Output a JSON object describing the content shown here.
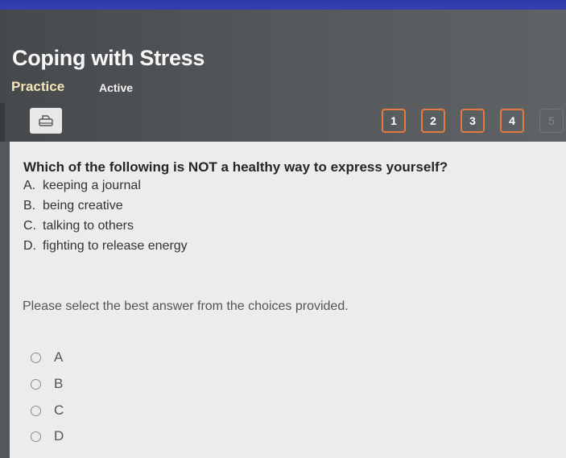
{
  "header": {
    "title": "Coping with Stress",
    "mode": "Practice",
    "status": "Active"
  },
  "toolbar": {
    "print_icon": "printer-icon"
  },
  "question_nav": [
    {
      "label": "1",
      "state": "enabled"
    },
    {
      "label": "2",
      "state": "enabled"
    },
    {
      "label": "3",
      "state": "enabled"
    },
    {
      "label": "4",
      "state": "enabled"
    },
    {
      "label": "5",
      "state": "disabled"
    }
  ],
  "colors": {
    "accent": "#e47b3c",
    "topbar": "#2e3aa8",
    "practice_label": "#f3e6b8"
  },
  "question": {
    "text": "Which of the following is NOT a healthy way to express yourself?",
    "choices": [
      {
        "letter": "A.",
        "text": "keeping a journal"
      },
      {
        "letter": "B.",
        "text": "being creative"
      },
      {
        "letter": "C.",
        "text": "talking to others"
      },
      {
        "letter": "D.",
        "text": "fighting to release energy"
      }
    ]
  },
  "instruction": "Please select the best answer from the choices provided.",
  "answers": [
    {
      "label": "A",
      "selected": false
    },
    {
      "label": "B",
      "selected": false
    },
    {
      "label": "C",
      "selected": false
    },
    {
      "label": "D",
      "selected": false
    }
  ]
}
